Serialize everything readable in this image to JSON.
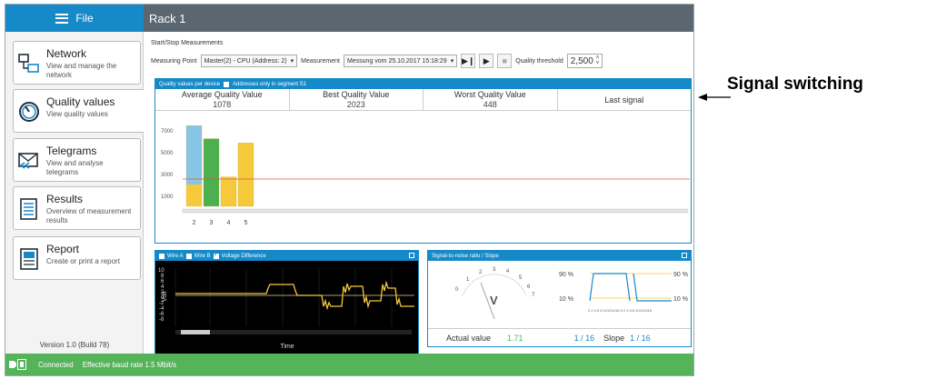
{
  "app": {
    "menu_label": "File",
    "window_title": "Rack 1"
  },
  "sidebar": {
    "items": [
      {
        "title": "Network",
        "subtitle": "View and manage the network",
        "icon": "network-icon"
      },
      {
        "title": "Quality values",
        "subtitle": "View quality values",
        "icon": "gauge-icon"
      },
      {
        "title": "Telegrams",
        "subtitle": "View and analyse telegrams",
        "icon": "envelope-icon"
      },
      {
        "title": "Results",
        "subtitle": "Overview of measurement results",
        "icon": "document-list-icon"
      },
      {
        "title": "Report",
        "subtitle": "Create or print a report",
        "icon": "report-icon"
      }
    ],
    "version": "Version 1.0 (Build 78)"
  },
  "controls": {
    "group_title": "Start/Stop Measurements",
    "measuring_point_label": "Measuring Point",
    "measuring_point_value": "Master(2) - CPU (Address: 2)",
    "measurement_label": "Measurement",
    "measurement_value": "Messung vom 25.10.2017 15:18:29",
    "quality_threshold_label": "Quality threshold",
    "quality_threshold_value": "2,500"
  },
  "quality": {
    "header": "Quality values per device",
    "segment_checkbox": "Addresses only in segment S1",
    "metrics": [
      {
        "label": "Average Quality Value",
        "value": "1078"
      },
      {
        "label": "Best Quality Value",
        "value": "2023"
      },
      {
        "label": "Worst Quality Value",
        "value": "448"
      }
    ],
    "last_signal_label": "Last signal"
  },
  "scope": {
    "wire_a": "Wire A",
    "wire_b": "Wire B",
    "voltage_diff": "Voltage Difference",
    "ylabel": "Volt",
    "xlabel": "Time"
  },
  "snr": {
    "header": "Signal-to-noise ratio / Slope",
    "gauge_unit": "V",
    "actual_label": "Actual value",
    "actual_value": "1.71",
    "page_left": "1 / 16",
    "slope_label": "Slope",
    "page_right": "1 / 16",
    "pct_high": "90 %",
    "pct_low": "10 %",
    "axis_ticks": "0 2 4 6 8 10121416 0 2 4 6 8 10121416"
  },
  "status": {
    "connection": "Connected",
    "baud": "Effective baud rate 1.5 Mbit/s"
  },
  "annotation": {
    "text": "Signal switching"
  },
  "colors": {
    "blue": "#1689c8",
    "green_bar": "#4caf50",
    "yellow_bar": "#f6c93a",
    "light_blue_bar": "#86c5e6",
    "threshold": "#e05a2c",
    "status_green": "#55b45a"
  },
  "chart_data": {
    "type": "bar",
    "categories": [
      "2",
      "3",
      "4",
      "5"
    ],
    "series": [
      {
        "name": "",
        "values": [
          7400,
          6200,
          2700,
          5800
        ]
      }
    ],
    "threshold": 2500,
    "y_ticks": [
      "7000",
      "5000",
      "3000",
      "1000"
    ],
    "ylim": [
      0,
      8000
    ]
  }
}
